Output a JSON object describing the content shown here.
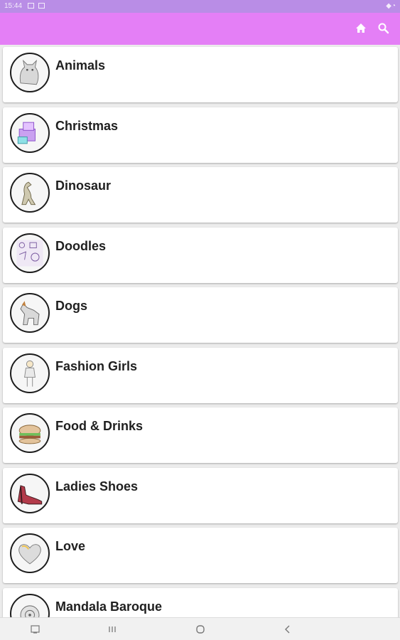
{
  "status_bar": {
    "time": "15:44"
  },
  "toolbar": {
    "home_icon": "home-icon",
    "search_icon": "search-icon",
    "accent": "#e47ff6"
  },
  "categories": [
    {
      "label": "Animals",
      "thumb": "cat"
    },
    {
      "label": "Christmas",
      "thumb": "gift"
    },
    {
      "label": "Dinosaur",
      "thumb": "dino"
    },
    {
      "label": "Doodles",
      "thumb": "doodle"
    },
    {
      "label": "Dogs",
      "thumb": "dog"
    },
    {
      "label": "Fashion Girls",
      "thumb": "girl"
    },
    {
      "label": "Food & Drinks",
      "thumb": "burger"
    },
    {
      "label": "Ladies Shoes",
      "thumb": "shoe"
    },
    {
      "label": "Love",
      "thumb": "heart"
    },
    {
      "label": "Mandala Baroque",
      "thumb": "mandala"
    }
  ],
  "nav": [
    "recent-apps-icon",
    "home-circle-icon",
    "back-icon"
  ]
}
